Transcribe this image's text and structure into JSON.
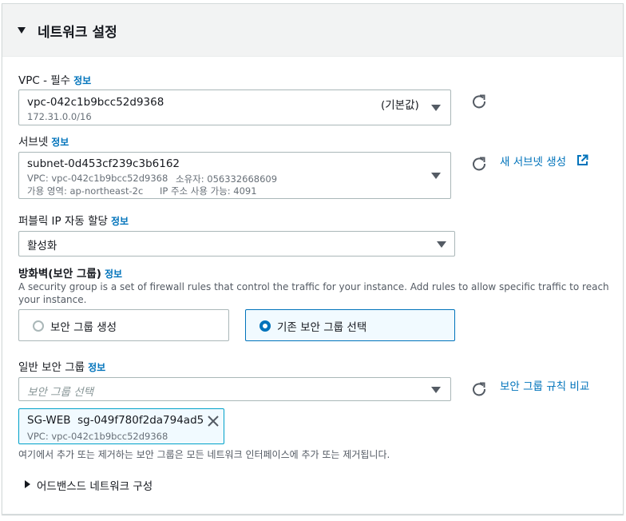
{
  "section": {
    "title": "네트워크 설정",
    "info_link": "정보"
  },
  "vpc": {
    "label": "VPC - 필수",
    "value": "vpc-042c1b9bcc52d9368",
    "tag": "(기본값)",
    "cidr": "172.31.0.0/16"
  },
  "subnet": {
    "label": "서브넷",
    "value": "subnet-0d453cf239c3b6162",
    "vpc_line": "VPC: vpc-042c1b9bcc52d9368",
    "owner_line": "소유자: 056332668609",
    "az_line": "가용 영역: ap-northeast-2c",
    "ip_line": "IP 주소 사용 가능: 4091",
    "create_link": "새 서브넷 생성"
  },
  "public_ip": {
    "label": "퍼블릭 IP 자동 할당",
    "value": "활성화"
  },
  "firewall": {
    "label": "방화벽(보안 그룹)",
    "description": "A security group is a set of firewall rules that control the traffic for your instance. Add rules to allow specific traffic to reach your instance.",
    "options": [
      {
        "label": "보안 그룹 생성",
        "selected": false
      },
      {
        "label": "기존 보안 그룹 선택",
        "selected": true
      }
    ]
  },
  "common_sg": {
    "label": "일반 보안 그룹",
    "placeholder": "보안 그룹 선택",
    "compare_link": "보안 그룹 규칙 비교",
    "token_name": "SG-WEB",
    "token_id": "sg-049f780f2da794ad5",
    "token_vpc": "VPC: vpc-042c1b9bcc52d9368",
    "hint": "여기에서 추가 또는 제거하는 보안 그룹은 모든 네트워크 인터페이스에 추가 또는 제거됩니다."
  },
  "advanced": {
    "title": "어드밴스드 네트워크 구성"
  },
  "colors": {
    "link": "#0073bb",
    "selected_border": "#0073bb",
    "selected_bg": "#f1faff",
    "header_bg": "#f2f3f3"
  },
  "icons": [
    "caret-down-icon",
    "refresh-icon",
    "external-link-icon",
    "close-icon",
    "caret-right-icon"
  ]
}
